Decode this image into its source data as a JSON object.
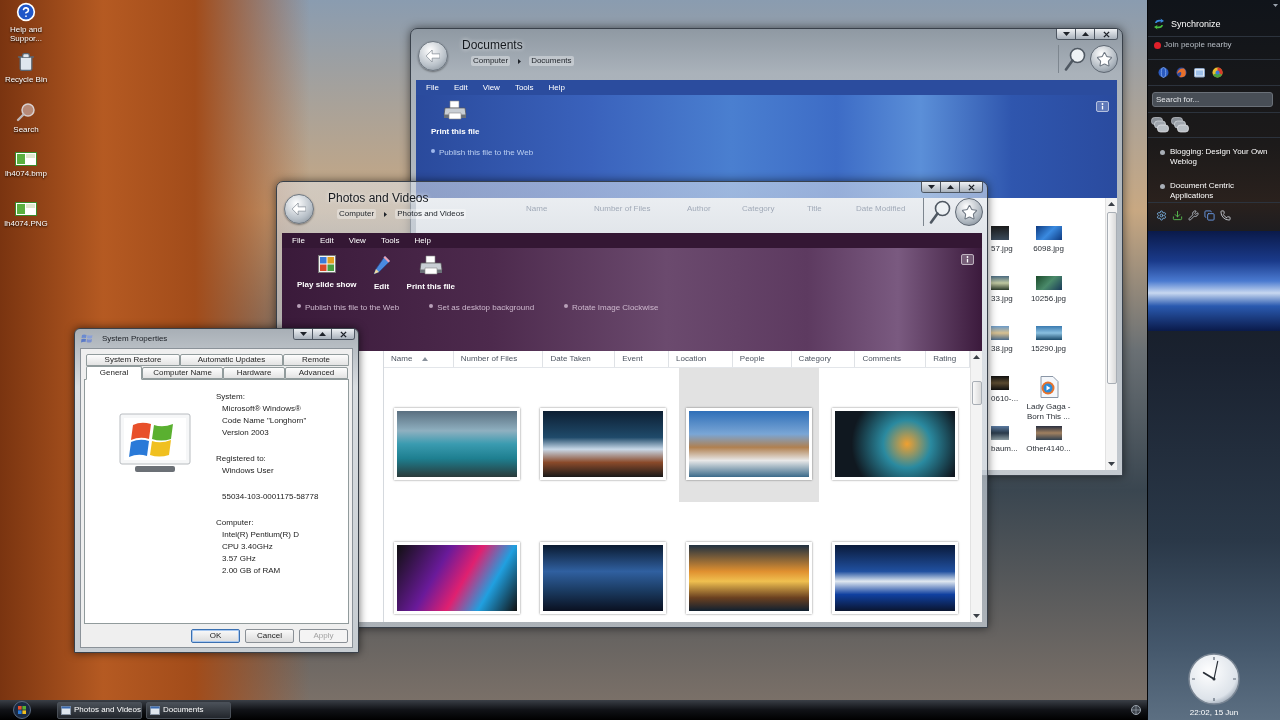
{
  "desktop": {
    "icons": [
      {
        "label": "Help and Suppor...",
        "kind": "help"
      },
      {
        "label": "Recycle Bin",
        "kind": "recycle"
      },
      {
        "label": "Search",
        "kind": "search"
      },
      {
        "label": "lh4074.bmp",
        "kind": "image"
      },
      {
        "label": "lh4074.PNG",
        "kind": "image"
      }
    ]
  },
  "documents_window": {
    "title": "Documents",
    "breadcrumb": [
      "Computer",
      "Documents"
    ],
    "menu": [
      "File",
      "Edit",
      "View",
      "Tools",
      "Help"
    ],
    "tasks": [
      {
        "label": "Print this file",
        "kind": "print"
      }
    ],
    "links": [
      "Publish this file to the Web"
    ],
    "columns": [
      "Name",
      "Number of Files",
      "Author",
      "Category",
      "Title",
      "Date Modified"
    ],
    "files": [
      {
        "name": "57.jpg",
        "kind": "photo"
      },
      {
        "name": "6098.jpg",
        "kind": "photo"
      },
      {
        "name": "33.jpg",
        "kind": "photo"
      },
      {
        "name": "10256.jpg",
        "kind": "photo"
      },
      {
        "name": "38.jpg",
        "kind": "photo"
      },
      {
        "name": "15290.jpg",
        "kind": "photo"
      },
      {
        "name": "0610-...",
        "kind": "photo"
      },
      {
        "name": "Lady Gaga - Born This ...",
        "kind": "video"
      },
      {
        "name": "baum...",
        "kind": "photo"
      },
      {
        "name": "Other4140...",
        "kind": "photo"
      }
    ]
  },
  "photos_window": {
    "title": "Photos and Videos",
    "breadcrumb": [
      "Computer",
      "Photos and Videos"
    ],
    "menu": [
      "File",
      "Edit",
      "View",
      "Tools",
      "Help"
    ],
    "tasks": [
      {
        "label": "Play slide show",
        "kind": "slideshow"
      },
      {
        "label": "Edit",
        "kind": "edit"
      },
      {
        "label": "Print this file",
        "kind": "print"
      }
    ],
    "links": [
      "Publish this file to the Web",
      "Set as desktop background",
      "Rotate Image Clockwise"
    ],
    "columns": [
      {
        "label": "Name",
        "sorted": true
      },
      {
        "label": "Number of Files",
        "sorted": false
      },
      {
        "label": "Date Taken",
        "sorted": false
      },
      {
        "label": "Event",
        "sorted": false
      },
      {
        "label": "Location",
        "sorted": false
      },
      {
        "label": "People",
        "sorted": false
      },
      {
        "label": "Category",
        "sorted": false
      },
      {
        "label": "Comments",
        "sorted": false
      },
      {
        "label": "Rating",
        "sorted": false
      }
    ],
    "photos": [
      {
        "selected": false
      },
      {
        "selected": false
      },
      {
        "selected": true
      },
      {
        "selected": false
      },
      {
        "selected": false
      },
      {
        "selected": false
      },
      {
        "selected": false
      },
      {
        "selected": false
      }
    ]
  },
  "system_properties": {
    "title": "System Properties",
    "tab_rows": [
      [
        {
          "label": "System Restore",
          "selected": false
        },
        {
          "label": "Automatic Updates",
          "selected": false
        },
        {
          "label": "Remote",
          "selected": false
        }
      ],
      [
        {
          "label": "General",
          "selected": true
        },
        {
          "label": "Computer Name",
          "selected": false
        },
        {
          "label": "Hardware",
          "selected": false
        },
        {
          "label": "Advanced",
          "selected": false
        }
      ]
    ],
    "sections": [
      {
        "heading": "System:",
        "lines": [
          "Microsoft® Windows®",
          "Code Name \"Longhorn\"",
          "Version 2003"
        ]
      },
      {
        "heading": "Registered to:",
        "lines": [
          "Windows User"
        ]
      },
      {
        "lines": [
          "55034-103-0001175-58778"
        ]
      },
      {
        "heading": "Computer:",
        "lines": [
          "Intel(R) Pentium(R) D",
          "CPU 3.40GHz",
          "3.57 GHz",
          "2.00 GB of RAM"
        ]
      }
    ],
    "buttons": [
      {
        "label": "OK",
        "default": true,
        "disabled": false
      },
      {
        "label": "Cancel",
        "default": false,
        "disabled": false
      },
      {
        "label": "Apply",
        "default": false,
        "disabled": true
      }
    ]
  },
  "taskbar": {
    "buttons": [
      "Photos and Videos",
      "Documents"
    ]
  },
  "sidebar": {
    "items": [
      {
        "label": "Synchronize",
        "kind": "sync"
      },
      {
        "label": "Join people nearby",
        "kind": "presence"
      }
    ],
    "search": {
      "placeholder": "Search for..."
    },
    "links": [
      "Blogging: Design Your Own Weblog",
      "Document Centric Applications"
    ],
    "clock": {
      "label": "22:02, 15 Jun"
    }
  }
}
